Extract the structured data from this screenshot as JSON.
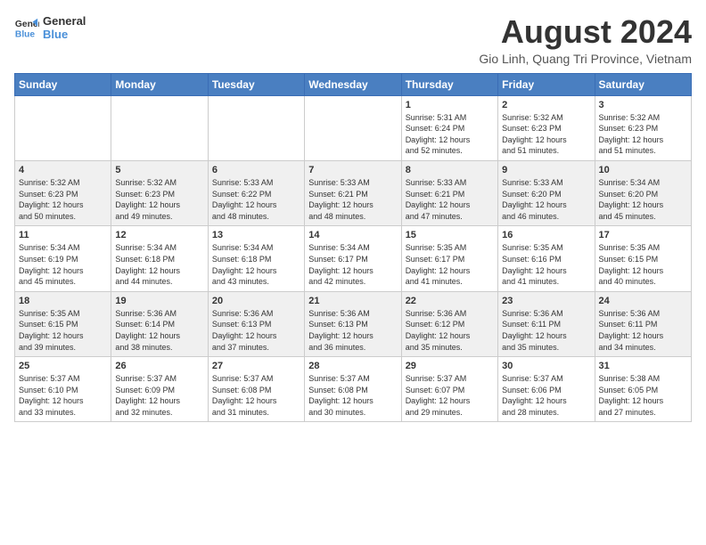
{
  "logo": {
    "line1": "General",
    "line2": "Blue"
  },
  "title": {
    "month_year": "August 2024",
    "location": "Gio Linh, Quang Tri Province, Vietnam"
  },
  "days_of_week": [
    "Sunday",
    "Monday",
    "Tuesday",
    "Wednesday",
    "Thursday",
    "Friday",
    "Saturday"
  ],
  "weeks": [
    [
      {
        "day": "",
        "info": ""
      },
      {
        "day": "",
        "info": ""
      },
      {
        "day": "",
        "info": ""
      },
      {
        "day": "",
        "info": ""
      },
      {
        "day": "1",
        "info": "Sunrise: 5:31 AM\nSunset: 6:24 PM\nDaylight: 12 hours\nand 52 minutes."
      },
      {
        "day": "2",
        "info": "Sunrise: 5:32 AM\nSunset: 6:23 PM\nDaylight: 12 hours\nand 51 minutes."
      },
      {
        "day": "3",
        "info": "Sunrise: 5:32 AM\nSunset: 6:23 PM\nDaylight: 12 hours\nand 51 minutes."
      }
    ],
    [
      {
        "day": "4",
        "info": "Sunrise: 5:32 AM\nSunset: 6:23 PM\nDaylight: 12 hours\nand 50 minutes."
      },
      {
        "day": "5",
        "info": "Sunrise: 5:32 AM\nSunset: 6:23 PM\nDaylight: 12 hours\nand 49 minutes."
      },
      {
        "day": "6",
        "info": "Sunrise: 5:33 AM\nSunset: 6:22 PM\nDaylight: 12 hours\nand 48 minutes."
      },
      {
        "day": "7",
        "info": "Sunrise: 5:33 AM\nSunset: 6:21 PM\nDaylight: 12 hours\nand 48 minutes."
      },
      {
        "day": "8",
        "info": "Sunrise: 5:33 AM\nSunset: 6:21 PM\nDaylight: 12 hours\nand 47 minutes."
      },
      {
        "day": "9",
        "info": "Sunrise: 5:33 AM\nSunset: 6:20 PM\nDaylight: 12 hours\nand 46 minutes."
      },
      {
        "day": "10",
        "info": "Sunrise: 5:34 AM\nSunset: 6:20 PM\nDaylight: 12 hours\nand 45 minutes."
      }
    ],
    [
      {
        "day": "11",
        "info": "Sunrise: 5:34 AM\nSunset: 6:19 PM\nDaylight: 12 hours\nand 45 minutes."
      },
      {
        "day": "12",
        "info": "Sunrise: 5:34 AM\nSunset: 6:18 PM\nDaylight: 12 hours\nand 44 minutes."
      },
      {
        "day": "13",
        "info": "Sunrise: 5:34 AM\nSunset: 6:18 PM\nDaylight: 12 hours\nand 43 minutes."
      },
      {
        "day": "14",
        "info": "Sunrise: 5:34 AM\nSunset: 6:17 PM\nDaylight: 12 hours\nand 42 minutes."
      },
      {
        "day": "15",
        "info": "Sunrise: 5:35 AM\nSunset: 6:17 PM\nDaylight: 12 hours\nand 41 minutes."
      },
      {
        "day": "16",
        "info": "Sunrise: 5:35 AM\nSunset: 6:16 PM\nDaylight: 12 hours\nand 41 minutes."
      },
      {
        "day": "17",
        "info": "Sunrise: 5:35 AM\nSunset: 6:15 PM\nDaylight: 12 hours\nand 40 minutes."
      }
    ],
    [
      {
        "day": "18",
        "info": "Sunrise: 5:35 AM\nSunset: 6:15 PM\nDaylight: 12 hours\nand 39 minutes."
      },
      {
        "day": "19",
        "info": "Sunrise: 5:36 AM\nSunset: 6:14 PM\nDaylight: 12 hours\nand 38 minutes."
      },
      {
        "day": "20",
        "info": "Sunrise: 5:36 AM\nSunset: 6:13 PM\nDaylight: 12 hours\nand 37 minutes."
      },
      {
        "day": "21",
        "info": "Sunrise: 5:36 AM\nSunset: 6:13 PM\nDaylight: 12 hours\nand 36 minutes."
      },
      {
        "day": "22",
        "info": "Sunrise: 5:36 AM\nSunset: 6:12 PM\nDaylight: 12 hours\nand 35 minutes."
      },
      {
        "day": "23",
        "info": "Sunrise: 5:36 AM\nSunset: 6:11 PM\nDaylight: 12 hours\nand 35 minutes."
      },
      {
        "day": "24",
        "info": "Sunrise: 5:36 AM\nSunset: 6:11 PM\nDaylight: 12 hours\nand 34 minutes."
      }
    ],
    [
      {
        "day": "25",
        "info": "Sunrise: 5:37 AM\nSunset: 6:10 PM\nDaylight: 12 hours\nand 33 minutes."
      },
      {
        "day": "26",
        "info": "Sunrise: 5:37 AM\nSunset: 6:09 PM\nDaylight: 12 hours\nand 32 minutes."
      },
      {
        "day": "27",
        "info": "Sunrise: 5:37 AM\nSunset: 6:08 PM\nDaylight: 12 hours\nand 31 minutes."
      },
      {
        "day": "28",
        "info": "Sunrise: 5:37 AM\nSunset: 6:08 PM\nDaylight: 12 hours\nand 30 minutes."
      },
      {
        "day": "29",
        "info": "Sunrise: 5:37 AM\nSunset: 6:07 PM\nDaylight: 12 hours\nand 29 minutes."
      },
      {
        "day": "30",
        "info": "Sunrise: 5:37 AM\nSunset: 6:06 PM\nDaylight: 12 hours\nand 28 minutes."
      },
      {
        "day": "31",
        "info": "Sunrise: 5:38 AM\nSunset: 6:05 PM\nDaylight: 12 hours\nand 27 minutes."
      }
    ]
  ]
}
